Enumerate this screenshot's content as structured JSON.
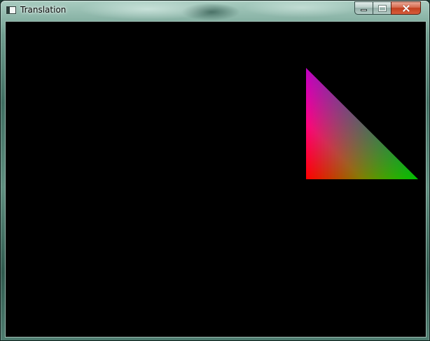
{
  "window": {
    "title": "Translation"
  },
  "icons": {
    "app": "app-window-icon",
    "minimize": "minimize-icon",
    "maximize": "maximize-icon",
    "close": "close-icon"
  },
  "colors": {
    "client_background": "#000000",
    "vertex_top": "#0000ff",
    "vertex_bottom_left": "#ff0000",
    "vertex_bottom_right": "#00ff00"
  }
}
